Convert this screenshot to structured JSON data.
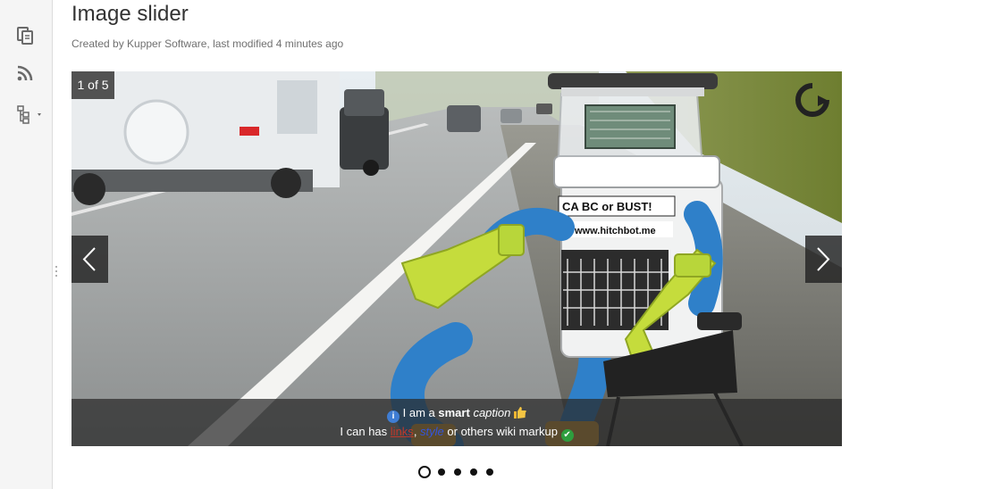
{
  "page": {
    "title": "Image slider",
    "byline": "Created by Kupper Software, last modified 4 minutes ago"
  },
  "sidebar": {
    "icons": [
      "pages-icon",
      "rss-feed-icon",
      "page-tree-icon"
    ]
  },
  "slider": {
    "counter": "1 of 5",
    "image_text": {
      "sign_line_1": "CA BC or BUST!",
      "sign_line_2": "www.hitchbot.me"
    },
    "caption": {
      "line1_pre": "I am a",
      "line1_bold": "smart",
      "line1_italic": "caption",
      "line2_pre": "I can has",
      "line2_link": "links",
      "line2_sep": ", ",
      "line2_style": "style",
      "line2_post": "or others wiki markup"
    },
    "total_slides": 5,
    "active_index": 0
  },
  "colors": {
    "caption_bg": "#282828",
    "info_icon": "#3f7dd3",
    "check_icon": "#2e9e3e"
  }
}
